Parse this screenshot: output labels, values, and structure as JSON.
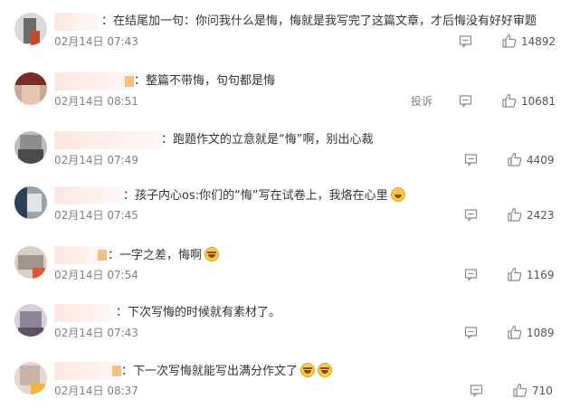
{
  "comments": [
    {
      "text": "：在结尾加一句：你问我什么是悔，悔就是我写完了这篇文章，才后悔没有好好审题",
      "date": "02月14日 07:43",
      "likes": "14892",
      "report": "",
      "emoji": []
    },
    {
      "text": "：整篇不带悔，句句都是悔",
      "date": "02月14日 08:51",
      "likes": "10681",
      "report": "投诉",
      "emoji": []
    },
    {
      "text": "：跑题作文的立意就是“悔”啊，别出心裁",
      "date": "02月14日 07:49",
      "likes": "4409",
      "report": "",
      "emoji": []
    },
    {
      "text": "：孩子内心os:你们的“悔”写在试卷上，我烙在心里",
      "date": "02月14日 07:45",
      "likes": "2423",
      "report": "",
      "emoji": [
        "smile-emoji"
      ]
    },
    {
      "text": "：一字之差，悔啊",
      "date": "02月14日 07:54",
      "likes": "1169",
      "report": "",
      "emoji": [
        "laugh-cry-emoji"
      ]
    },
    {
      "text": "：下次写悔的时候就有素材了。",
      "date": "02月14日 07:43",
      "likes": "1089",
      "report": "",
      "emoji": []
    },
    {
      "text": "：下一次写悔就能写出满分作文了",
      "date": "02月14日 08:37",
      "likes": "710",
      "report": "",
      "emoji": [
        "laugh-cry-emoji",
        "laugh-cry-emoji"
      ]
    }
  ],
  "icons": {
    "reply": "comment-icon",
    "like": "thumbs-up-icon"
  },
  "colors": {
    "text": "#333333",
    "meta": "#808080",
    "icon": "#8a8a8a"
  }
}
